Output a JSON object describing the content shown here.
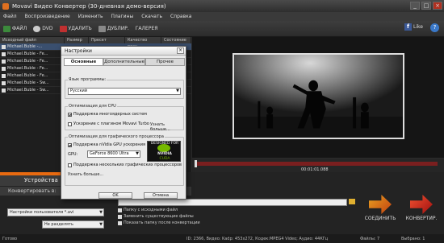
{
  "window": {
    "title": "Movavi Видео Конвертер (30-дневная демо-версия)",
    "controls": [
      "_",
      "□",
      "×"
    ]
  },
  "menu": [
    "Файл",
    "Воспроизведение",
    "Изменить",
    "Плагины",
    "Скачать",
    "Справка"
  ],
  "toolbar": {
    "file": "ФАЙЛ",
    "dvd": "DVD",
    "delete": "УДАЛИТЬ",
    "duplicate": "ДУБЛИР.",
    "gallery": "ГАЛЕРЕЯ",
    "like": "Like"
  },
  "file_list": {
    "columns": [
      "Исходный файл",
      "Размер",
      "Пресет",
      "Качество резу...",
      "Состояние"
    ],
    "rows": [
      "Michael.Buble -...",
      "Michael.Buble - Fe...",
      "Michael.Buble - Fe...",
      "Michael.Buble - Fe...",
      "Michael.Buble - Fe...",
      "Michael.Buble - Sw...",
      "Michael.Buble - Sw..."
    ]
  },
  "dialog": {
    "title": "Настройки",
    "close": "×",
    "tabs": [
      "Основные",
      "Дополнительные",
      "Прочее"
    ],
    "language": {
      "legend": "Язык программы:",
      "value": "Русский"
    },
    "cpu": {
      "legend": "Оптимизация для CPU",
      "multicore": "Поддержка многоядерных систем",
      "turbo": "Ускорение с плагином Movavi Turbo",
      "more": "Узнать больше..."
    },
    "gpu": {
      "legend": "Оптимизация для графического процессора",
      "cuda": "Поддержка nVidia GPU ускорения",
      "gpu_label": "GPU:",
      "gpu_value": "GeForce 8600 Ultra",
      "multi_gpu": "Поддержка нескольких графических процессоров",
      "more": "Узнать больше...",
      "badge_top": "DESIGNED FOR",
      "badge_brand": "NVIDIA",
      "badge_bottom": "CUDA"
    },
    "ok": "OK",
    "cancel": "Отмена"
  },
  "player": {
    "time": "00:01:01.088",
    "controls": [
      "◀◀",
      "◀",
      "▶",
      "▶",
      "▶▶"
    ],
    "volume_icon": "🔈"
  },
  "bottom": {
    "devices_tab": "Устройства",
    "convert_to": "Конвертировать в:",
    "preset": "Настройки пользователя *.avi",
    "split": "Не разделять",
    "source_folder": "Папку с исходными файл",
    "replace_files": "Заменить существующие файлы",
    "show_folder": "Показать папку после конвертации",
    "join": "СОЕДИНИТЬ",
    "convert": "КОНВЕРТИР."
  },
  "status": {
    "left": "Готово",
    "info": "ID: 2366, Видео: Kadp: 453x272, Кодек:MPEG4 Video; Аудио: 44КГц",
    "files": "Файлы: 7",
    "selected": "Выбрано: 1"
  },
  "colors": {
    "accent_orange": "#e86a10",
    "timeline_red": "#7a1f1f",
    "nvidia_green": "#76b900"
  }
}
